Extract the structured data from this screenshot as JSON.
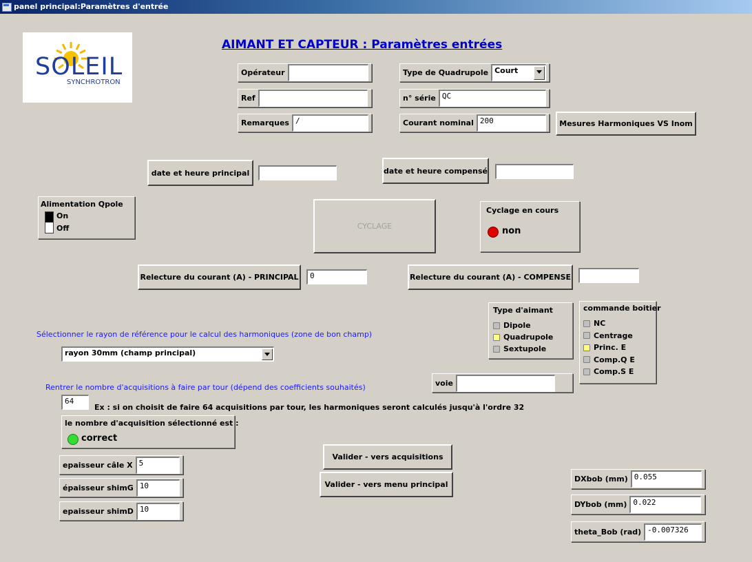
{
  "window": {
    "title": "panel principal:Paramètres d'entrée"
  },
  "logo": {
    "name": "SOLEIL",
    "sub": "SYNCHROTRON"
  },
  "header": {
    "title": "AIMANT ET CAPTEUR : Paramètres entrées"
  },
  "operator": {
    "label": "Opérateur",
    "value": ""
  },
  "ref": {
    "label": "Ref",
    "value": ""
  },
  "remarks": {
    "label": "Remarques",
    "value": "/"
  },
  "quad_type": {
    "label": "Type de Quadrupole",
    "value": "Court"
  },
  "serial": {
    "label": "n° série",
    "value": "QC"
  },
  "nominal_current": {
    "label": "Courant nominal",
    "value": "200"
  },
  "harmonics_button": "Mesures Harmoniques VS Inom",
  "date_principal": {
    "button": "date et heure principal",
    "value": ""
  },
  "date_compense": {
    "button": "date et heure compensé",
    "value": ""
  },
  "power": {
    "title": "Alimentation Qpole",
    "on": "On",
    "off": "Off",
    "state": "On"
  },
  "cyclage_button": "CYCLAGE",
  "cycling": {
    "title": "Cyclage en cours",
    "status": "non",
    "color": "#e00000"
  },
  "readback_principal": {
    "button": "Relecture du courant (A) - PRINCIPAL",
    "value": "0"
  },
  "readback_compense": {
    "button": "Relecture du courant (A) - COMPENSE",
    "value": ""
  },
  "magnet_type": {
    "title": "Type d'aimant",
    "options": [
      "Dipole",
      "Quadrupole",
      "Sextupole"
    ],
    "selected": "Quadrupole"
  },
  "box_command": {
    "title": "commande boitier",
    "options": [
      "NC",
      "Centrage",
      "Princ. E",
      "Comp.Q E",
      "Comp.S E"
    ],
    "selected": "Princ. E"
  },
  "voie": {
    "label": "voie",
    "value": ""
  },
  "radius": {
    "prompt": "Sélectionner le rayon de référence pour le calcul des harmoniques (zone de bon champ)",
    "value": "rayon 30mm (champ principal)"
  },
  "acquisitions": {
    "prompt": "Rentrer le nombre d'acquisitions à faire par tour (dépend des coefficients souhaités)",
    "value": "64",
    "example": "Ex : si on choisit de faire 64 acquisitions par tour, les harmoniques seront calculés jusqu'à l'ordre 32",
    "check_title": "le nombre d'acquisition sélectionné est :",
    "check_status": "correct",
    "check_color": "#33dd33"
  },
  "cale_x": {
    "label": "epaisseur câle X",
    "value": "5"
  },
  "shim_g": {
    "label": "épaisseur shimG",
    "value": "10"
  },
  "shim_d": {
    "label": "epaisseur shimD",
    "value": "10"
  },
  "validate_acq": "Valider - vers acquisitions",
  "validate_menu": "Valider - vers menu principal",
  "dxbob": {
    "label": "DXbob (mm)",
    "value": "0.055"
  },
  "dybob": {
    "label": "DYbob (mm)",
    "value": "0.022"
  },
  "theta": {
    "label": "theta_Bob (rad)",
    "value": "-0.007326"
  }
}
